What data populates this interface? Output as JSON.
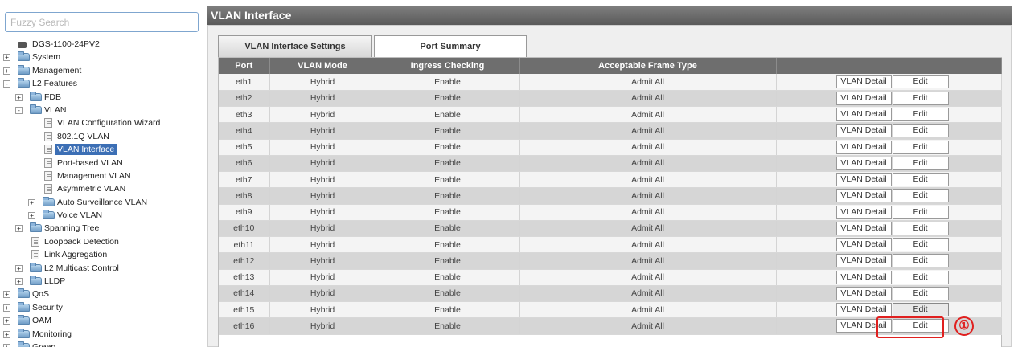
{
  "search": {
    "placeholder": "Fuzzy Search",
    "value": ""
  },
  "tree": [
    {
      "label": "DGS-1100-24PV2",
      "level": 0,
      "icon": "device-icon",
      "expander": ""
    },
    {
      "label": "System",
      "level": 0,
      "icon": "folder-icon",
      "expander": "+"
    },
    {
      "label": "Management",
      "level": 0,
      "icon": "folder-icon",
      "expander": "+"
    },
    {
      "label": "L2 Features",
      "level": 0,
      "icon": "folder-open-icon",
      "expander": "-"
    },
    {
      "label": "FDB",
      "level": 1,
      "icon": "folder-icon",
      "expander": "+"
    },
    {
      "label": "VLAN",
      "level": 1,
      "icon": "folder-open-icon",
      "expander": "-"
    },
    {
      "label": "VLAN Configuration Wizard",
      "level": 2,
      "icon": "page-icon",
      "expander": ""
    },
    {
      "label": "802.1Q VLAN",
      "level": 2,
      "icon": "page-icon",
      "expander": ""
    },
    {
      "label": "VLAN Interface",
      "level": 2,
      "icon": "page-icon",
      "expander": "",
      "selected": true
    },
    {
      "label": "Port-based VLAN",
      "level": 2,
      "icon": "page-icon",
      "expander": ""
    },
    {
      "label": "Management VLAN",
      "level": 2,
      "icon": "page-icon",
      "expander": ""
    },
    {
      "label": "Asymmetric VLAN",
      "level": 2,
      "icon": "page-icon",
      "expander": ""
    },
    {
      "label": "Auto Surveillance VLAN",
      "level": 2,
      "icon": "folder-icon",
      "expander": "+"
    },
    {
      "label": "Voice VLAN",
      "level": 2,
      "icon": "folder-icon",
      "expander": "+"
    },
    {
      "label": "Spanning Tree",
      "level": 1,
      "icon": "folder-icon",
      "expander": "+"
    },
    {
      "label": "Loopback Detection",
      "level": 1,
      "icon": "page-icon",
      "expander": ""
    },
    {
      "label": "Link Aggregation",
      "level": 1,
      "icon": "page-icon",
      "expander": ""
    },
    {
      "label": "L2 Multicast Control",
      "level": 1,
      "icon": "folder-icon",
      "expander": "+"
    },
    {
      "label": "LLDP",
      "level": 1,
      "icon": "folder-icon",
      "expander": "+"
    },
    {
      "label": "QoS",
      "level": 0,
      "icon": "folder-icon",
      "expander": "+"
    },
    {
      "label": "Security",
      "level": 0,
      "icon": "folder-icon",
      "expander": "+"
    },
    {
      "label": "OAM",
      "level": 0,
      "icon": "folder-icon",
      "expander": "+"
    },
    {
      "label": "Monitoring",
      "level": 0,
      "icon": "folder-icon",
      "expander": "+"
    },
    {
      "label": "Green",
      "level": 0,
      "icon": "folder-icon",
      "expander": "+"
    }
  ],
  "page": {
    "title": "VLAN Interface"
  },
  "tabs": [
    {
      "label": "VLAN Interface Settings",
      "active": true
    },
    {
      "label": "Port Summary",
      "active": false
    }
  ],
  "table": {
    "headers": [
      "Port",
      "VLAN Mode",
      "Ingress Checking",
      "Acceptable Frame Type",
      ""
    ],
    "detail_label": "VLAN Detail",
    "edit_label": "Edit",
    "rows": [
      [
        "eth1",
        "Hybrid",
        "Enable",
        "Admit All"
      ],
      [
        "eth2",
        "Hybrid",
        "Enable",
        "Admit All"
      ],
      [
        "eth3",
        "Hybrid",
        "Enable",
        "Admit All"
      ],
      [
        "eth4",
        "Hybrid",
        "Enable",
        "Admit All"
      ],
      [
        "eth5",
        "Hybrid",
        "Enable",
        "Admit All"
      ],
      [
        "eth6",
        "Hybrid",
        "Enable",
        "Admit All"
      ],
      [
        "eth7",
        "Hybrid",
        "Enable",
        "Admit All"
      ],
      [
        "eth8",
        "Hybrid",
        "Enable",
        "Admit All"
      ],
      [
        "eth9",
        "Hybrid",
        "Enable",
        "Admit All"
      ],
      [
        "eth10",
        "Hybrid",
        "Enable",
        "Admit All"
      ],
      [
        "eth11",
        "Hybrid",
        "Enable",
        "Admit All"
      ],
      [
        "eth12",
        "Hybrid",
        "Enable",
        "Admit All"
      ],
      [
        "eth13",
        "Hybrid",
        "Enable",
        "Admit All"
      ],
      [
        "eth14",
        "Hybrid",
        "Enable",
        "Admit All"
      ],
      [
        "eth15",
        "Hybrid",
        "Enable",
        "Admit All"
      ],
      [
        "eth16",
        "Hybrid",
        "Enable",
        "Admit All"
      ]
    ],
    "highlighted_row": "eth15"
  },
  "callout": {
    "label": "①",
    "color": "#e0201f"
  },
  "colors": {
    "selection": "#3c6fb5",
    "header": "#6e6e6e",
    "title_bar": "#6a6a6a"
  }
}
